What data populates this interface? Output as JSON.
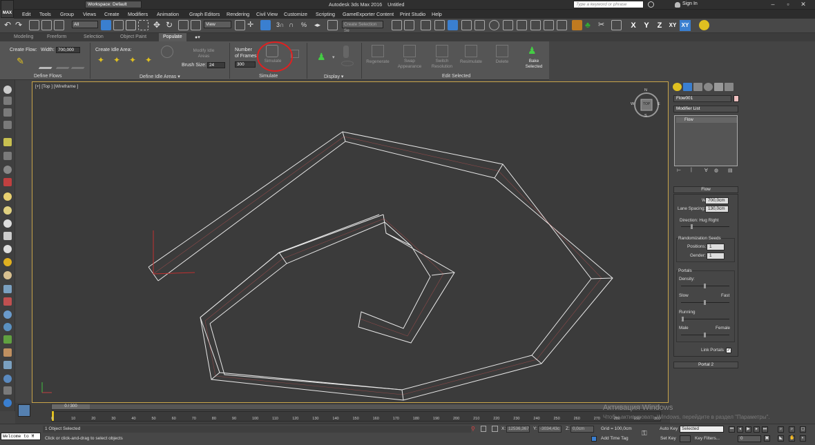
{
  "app": {
    "title": "Autodesk 3ds Max 2016",
    "document": "Untitled",
    "logo": "MAX",
    "workspace": "Workspace: Default",
    "search_placeholder": "Type a keyword or phrase",
    "sign_in": "Sign In"
  },
  "menu": [
    "Edit",
    "Tools",
    "Group",
    "Views",
    "Create",
    "Modifiers",
    "Animation",
    "Graph Editors",
    "Rendering",
    "Civil View",
    "Customize",
    "Scripting",
    "GameExporter",
    "Content",
    "Print Studio",
    "Help"
  ],
  "toolbar": {
    "selection_filter": "All",
    "ref_coord": "View",
    "named_selection": "Create Selection Se",
    "axes": [
      "X",
      "Y",
      "Z",
      "XY",
      "XY"
    ]
  },
  "ribbon_tabs": [
    "Modeling",
    "Freeform",
    "Selection",
    "Object Paint",
    "Populate"
  ],
  "ribbon": {
    "create_flow": "Create Flow:",
    "width_label": "Width:",
    "width_value": "700,000",
    "create_idle_area": "Create Idle Area:",
    "modify_idle_areas": "Modify Idle Areas",
    "brush_size_label": "Brush Size:",
    "brush_size_value": "24",
    "number_of_frames_1": "Number",
    "number_of_frames_2": "of Frames:",
    "frames_value": "300",
    "simulate": "Simulate",
    "regenerate": "Regenerate",
    "swap_appearance_1": "Swap",
    "swap_appearance_2": "Appearance",
    "switch_resolution_1": "Switch",
    "switch_resolution_2": "Resolution",
    "resimulate": "Resimulate",
    "delete": "Delete",
    "bake_selected_1": "Bake",
    "bake_selected_2": "Selected",
    "groups": {
      "define_flows": "Define Flows",
      "define_idle_areas": "Define Idle Areas",
      "simulate": "Simulate",
      "display": "Display",
      "edit_selected": "Edit Selected"
    }
  },
  "viewport": {
    "label": "[+] [Top ] [Wireframe ]",
    "viewcube_top": "TOP",
    "compass": {
      "n": "N",
      "s": "S",
      "e": "E",
      "w": "W"
    }
  },
  "command_panel": {
    "object_name": "Flow001",
    "modifier_list": "Modifier List",
    "stack_item": "Flow",
    "rollout_flow": "Flow",
    "width_label": "Width:",
    "width_value": "700,0cm",
    "lane_spacing_label": "Lane Spacing:",
    "lane_spacing_value": "130,0cm",
    "direction_label": "Direction: Hug Right",
    "rand_seeds_label": "Randomization Seeds",
    "positions_label": "Positions:",
    "positions_value": "1",
    "gender_label": "Gender:",
    "gender_value": "1",
    "portals_label": "Portals",
    "density_label": "Density:",
    "slow_label": "Slow",
    "fast_label": "Fast",
    "running_label": "Running",
    "male_label": "Male",
    "female_label": "Female",
    "link_portals": "Link Portals",
    "portal2": "Portal 2"
  },
  "timeline": {
    "frame_display": "0 / 300",
    "ticks": [
      "0",
      "10",
      "20",
      "30",
      "40",
      "50",
      "60",
      "70",
      "80",
      "90",
      "100",
      "110",
      "120",
      "130",
      "140",
      "150",
      "160",
      "170",
      "180",
      "190",
      "200",
      "210",
      "220",
      "230",
      "240",
      "250",
      "260",
      "270",
      "280",
      "290",
      "300"
    ]
  },
  "status": {
    "maxscript": "Welcome to M",
    "selected": "1 Object Selected",
    "prompt": "Click or click-and-drag to select objects",
    "x_label": "X:",
    "x_value": "12536,367",
    "y_label": "Y:",
    "y_value": "-3034,43c",
    "z_label": "Z:",
    "z_value": "0,0cm",
    "grid": "Grid = 100,0cm",
    "add_time_tag": "Add Time Tag",
    "auto_key": "Auto Key",
    "set_key": "Set Key",
    "key_mode": "Selected",
    "key_filters": "Key Filters...",
    "frame_value": "0"
  },
  "watermark": {
    "line1": "Активация Windows",
    "line2": "Чтобы активировать Windows, перейдите в раздел \"Параметры\"."
  },
  "colors": {
    "highlight_circle": "#e02020",
    "viewport_border": "#c9a54a",
    "wireframe": "#e8e8e8",
    "active_blue": "#3a7fd0"
  }
}
